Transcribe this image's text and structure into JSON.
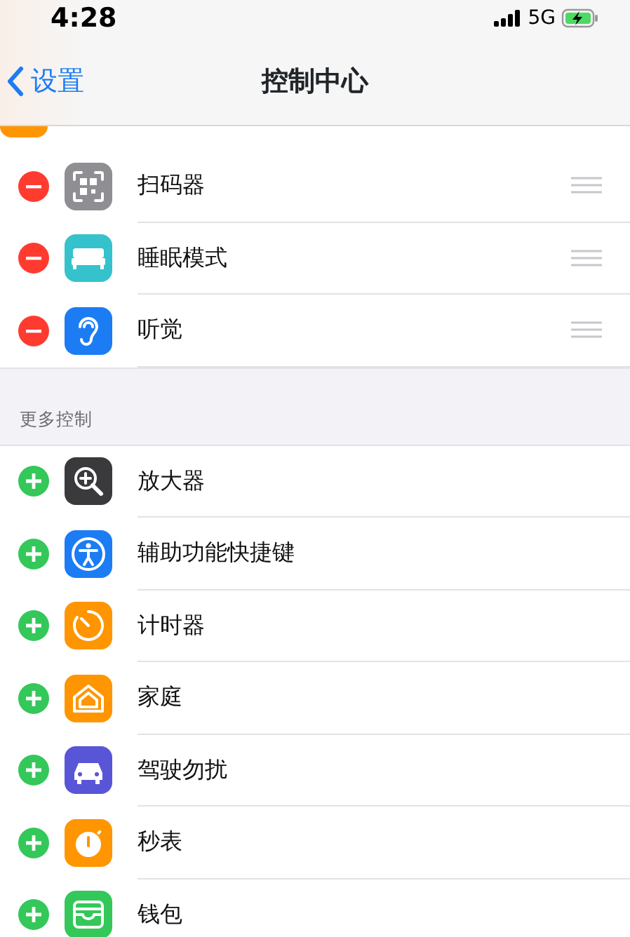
{
  "status_bar": {
    "time": "4:28",
    "network": "5G",
    "charging": true
  },
  "nav": {
    "back": "设置",
    "title": "控制中心"
  },
  "sections": [
    {
      "kind": "included",
      "partial_first": true,
      "items": [
        {
          "label": "扫码器",
          "color": "#8e8e93"
        },
        {
          "label": "睡眠模式",
          "color": "#35c2cc"
        },
        {
          "label": "听觉",
          "color": "#1c7cf4"
        }
      ]
    },
    {
      "kind": "more",
      "header": "更多控制",
      "items": [
        {
          "label": "放大器",
          "color": "#3a3a3c"
        },
        {
          "label": "辅助功能快捷键",
          "color": "#1c7cf4"
        },
        {
          "label": "计时器",
          "color": "#ff9500"
        },
        {
          "label": "家庭",
          "color": "#ff9500"
        },
        {
          "label": "驾驶勿扰",
          "color": "#5856d6"
        },
        {
          "label": "秒表",
          "color": "#ff9500"
        },
        {
          "label": "钱包",
          "color": "#34c759"
        }
      ]
    }
  ]
}
